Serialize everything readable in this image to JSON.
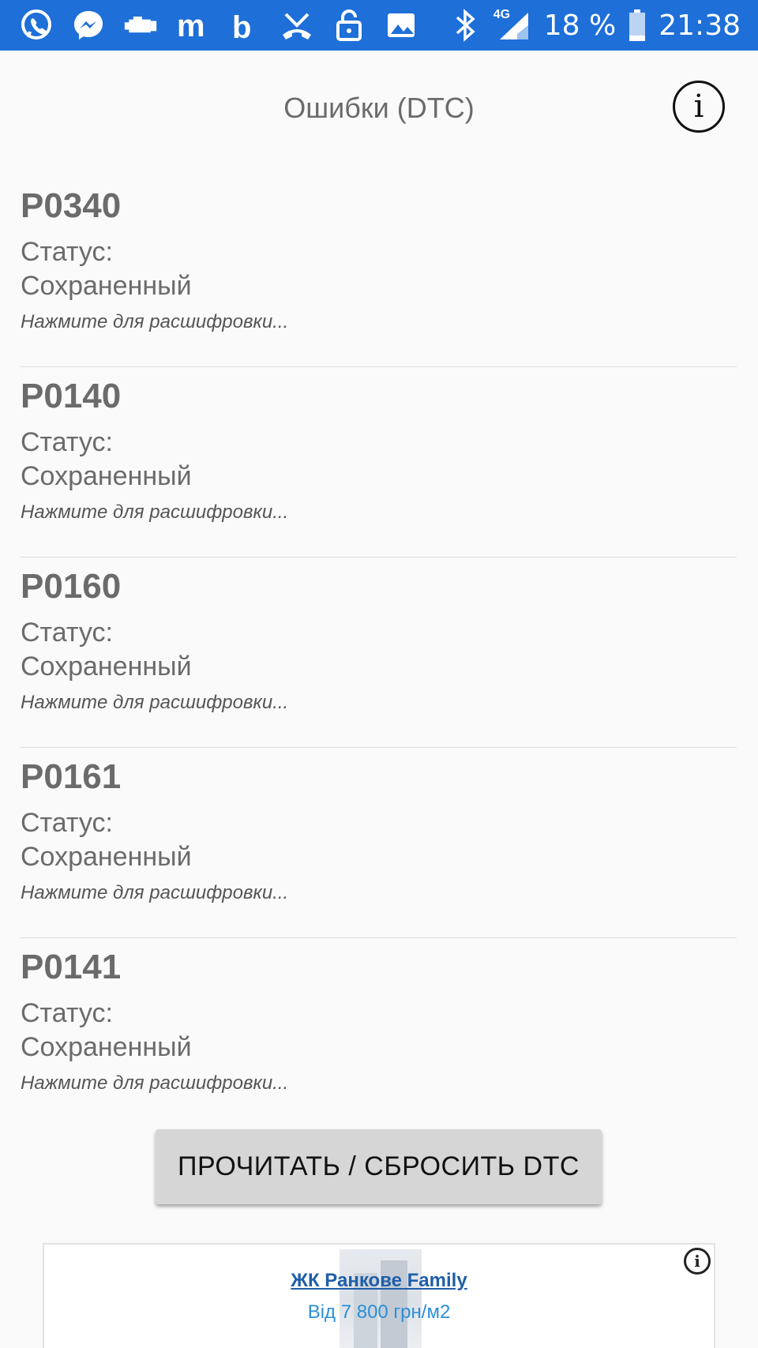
{
  "status_bar": {
    "icons_left": [
      "viber-icon",
      "messenger-icon",
      "car-engine-icon",
      "m-app-icon",
      "b-app-icon",
      "missed-call-icon",
      "lock-icon",
      "image-icon"
    ],
    "network": "4G",
    "battery": "18 %",
    "time": "21:38",
    "color": "#1e6fd8"
  },
  "header": {
    "title": "Ошибки (DTC)",
    "info_icon": "i"
  },
  "dtc_list": [
    {
      "code": "P0340",
      "status_label": "Статус:",
      "status_value": "Сохраненный",
      "hint": "Нажмите для расшифровки..."
    },
    {
      "code": "P0140",
      "status_label": "Статус:",
      "status_value": "Сохраненный",
      "hint": "Нажмите для расшифровки..."
    },
    {
      "code": "P0160",
      "status_label": "Статус:",
      "status_value": "Сохраненный",
      "hint": "Нажмите для расшифровки..."
    },
    {
      "code": "P0161",
      "status_label": "Статус:",
      "status_value": "Сохраненный",
      "hint": "Нажмите для расшифровки..."
    },
    {
      "code": "P0141",
      "status_label": "Статус:",
      "status_value": "Сохраненный",
      "hint": "Нажмите для расшифровки..."
    }
  ],
  "action_button": {
    "label": "ПРОЧИТАТЬ / СБРОСИТЬ DTC"
  },
  "ad": {
    "title": "ЖК Ранкове Family",
    "price": "Від 7 800 грн/м2",
    "info_icon": "i"
  }
}
